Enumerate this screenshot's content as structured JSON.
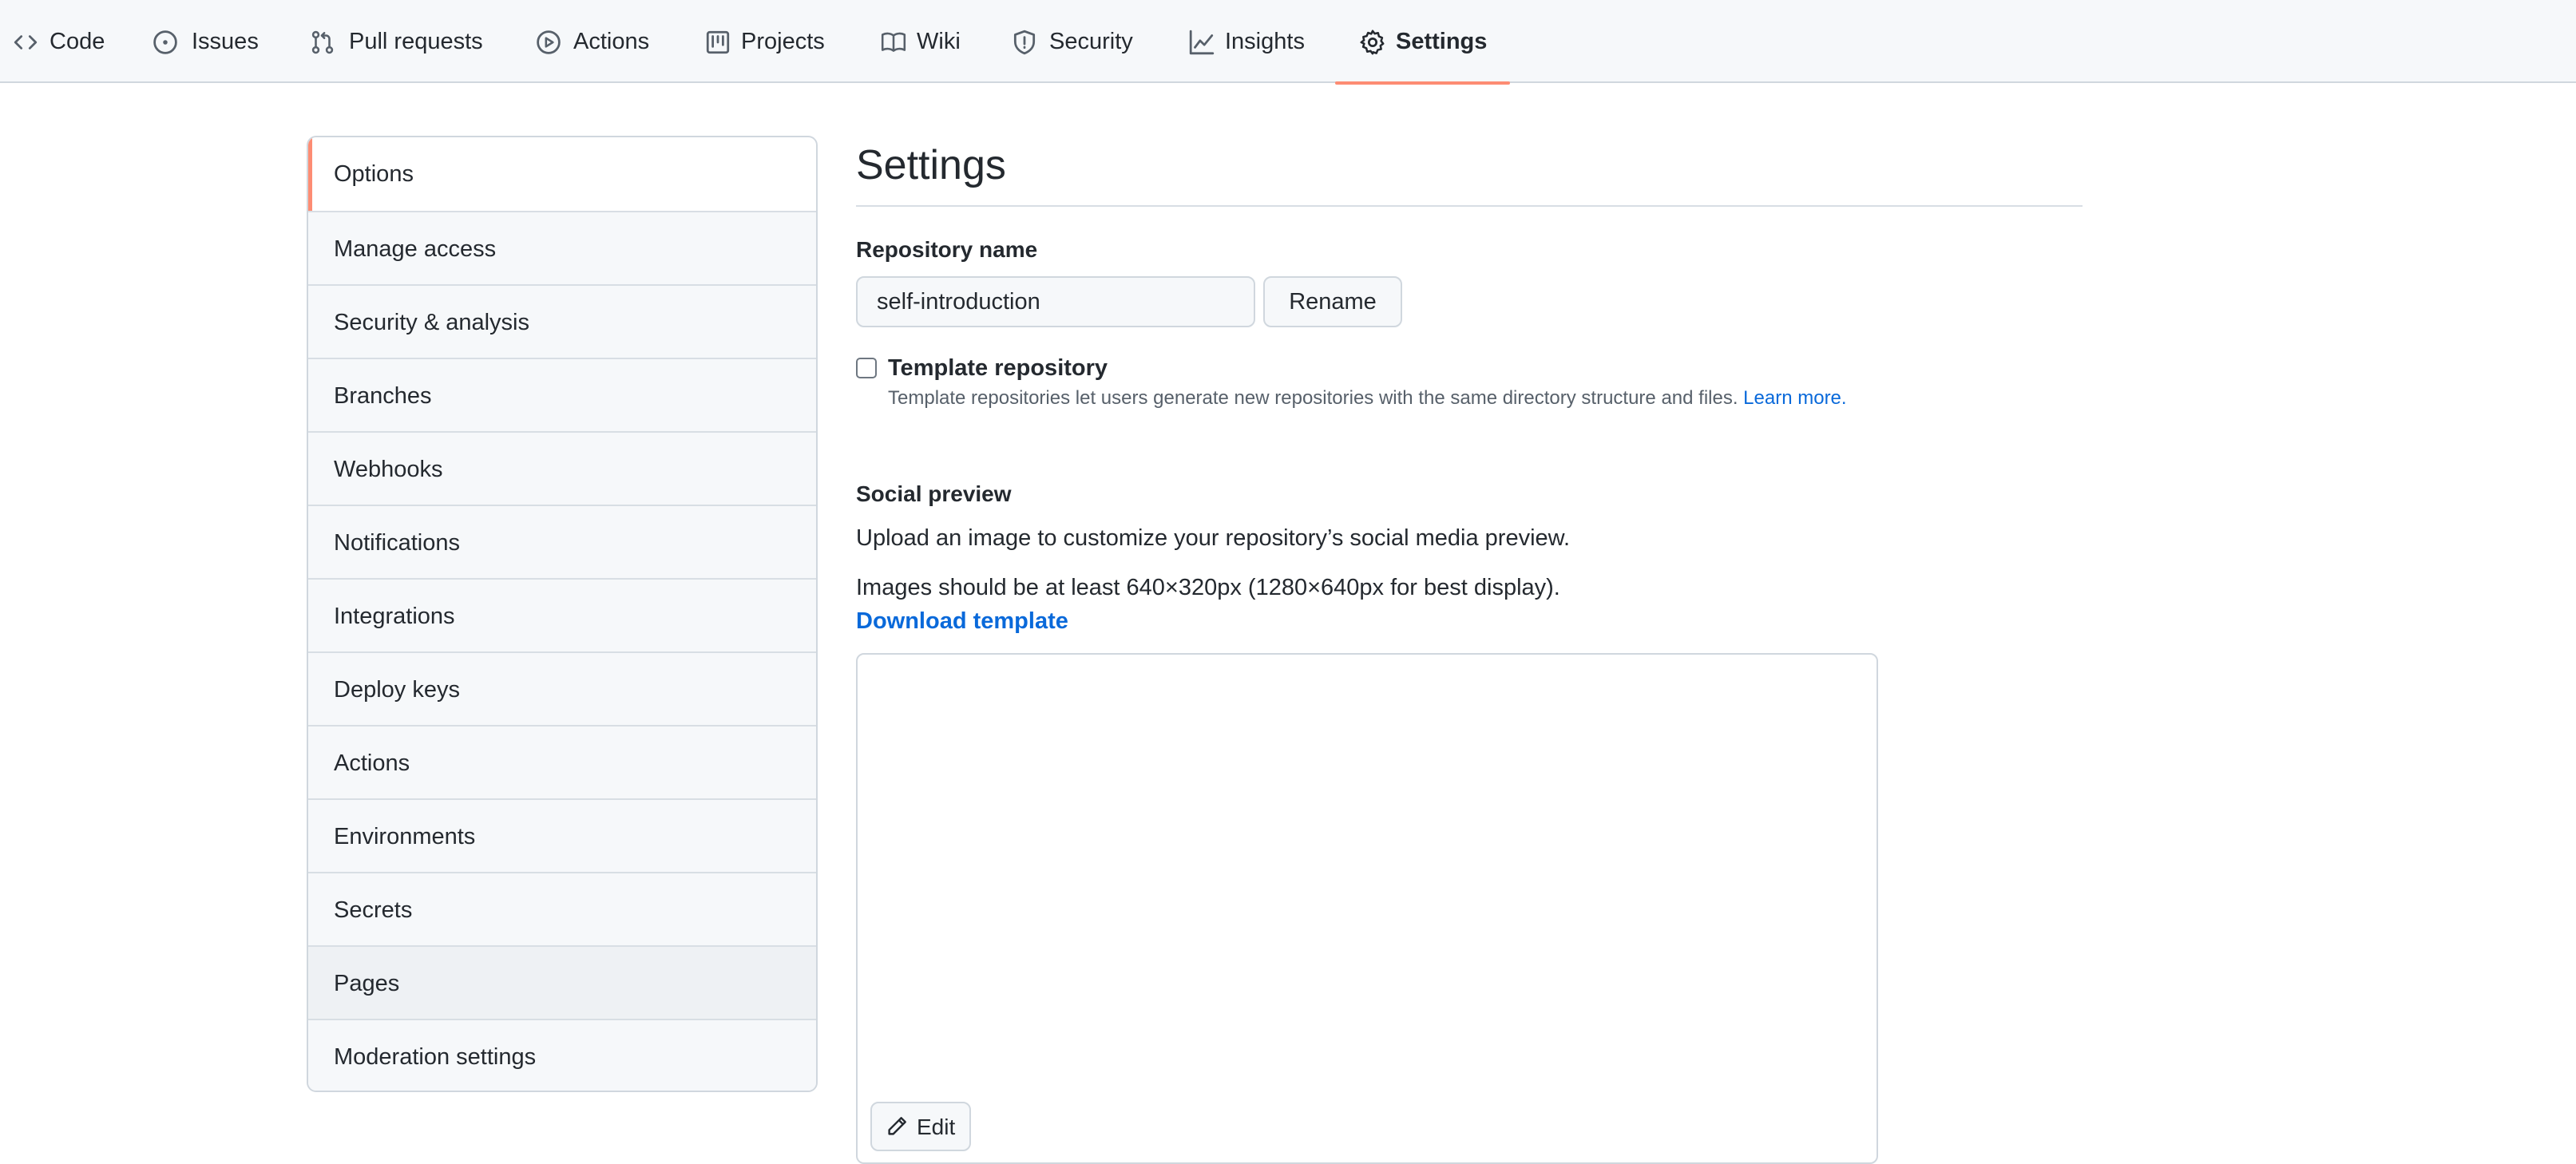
{
  "nav": {
    "tabs": [
      {
        "label": "Code",
        "icon": "code-icon"
      },
      {
        "label": "Issues",
        "icon": "issue-opened-icon"
      },
      {
        "label": "Pull requests",
        "icon": "git-pull-request-icon"
      },
      {
        "label": "Actions",
        "icon": "play-icon"
      },
      {
        "label": "Projects",
        "icon": "project-icon"
      },
      {
        "label": "Wiki",
        "icon": "book-icon"
      },
      {
        "label": "Security",
        "icon": "shield-icon"
      },
      {
        "label": "Insights",
        "icon": "graph-icon"
      },
      {
        "label": "Settings",
        "icon": "gear-icon",
        "selected": true
      }
    ]
  },
  "sidebar": {
    "items": [
      {
        "label": "Options",
        "selected": true
      },
      {
        "label": "Manage access"
      },
      {
        "label": "Security & analysis"
      },
      {
        "label": "Branches"
      },
      {
        "label": "Webhooks"
      },
      {
        "label": "Notifications"
      },
      {
        "label": "Integrations"
      },
      {
        "label": "Deploy keys"
      },
      {
        "label": "Actions"
      },
      {
        "label": "Environments"
      },
      {
        "label": "Secrets"
      },
      {
        "label": "Pages",
        "hovered": true
      },
      {
        "label": "Moderation settings"
      }
    ]
  },
  "main": {
    "title": "Settings",
    "repo_name_label": "Repository name",
    "repo_name_value": "self-introduction",
    "rename_button": "Rename",
    "template": {
      "label": "Template repository",
      "checked": false,
      "description": "Template repositories let users generate new repositories with the same directory structure and files.",
      "learn_more": "Learn more."
    },
    "social_preview": {
      "heading": "Social preview",
      "description": "Upload an image to customize your repository’s social media preview.",
      "size_hint": "Images should be at least 640×320px (1280×640px for best display).",
      "download_link": "Download template",
      "edit_button": "Edit"
    }
  },
  "colors": {
    "accent_underline": "#fd8c73",
    "link": "#0969da",
    "border": "#d0d7de",
    "nav_bg": "#f6f8fa"
  }
}
